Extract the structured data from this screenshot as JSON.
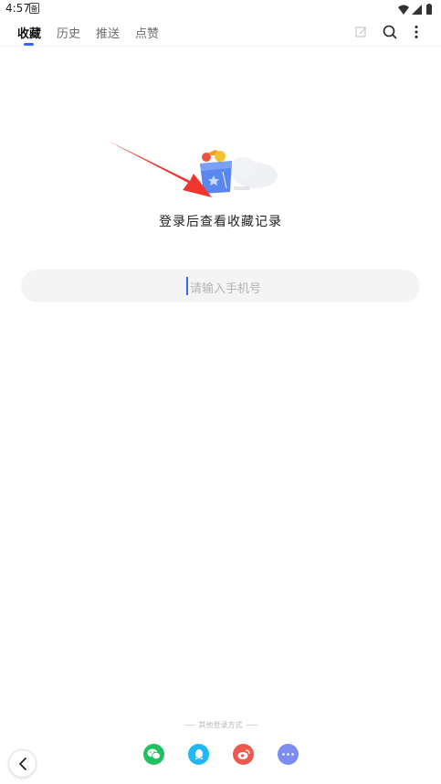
{
  "status_bar": {
    "time": "4:57",
    "badge": "备"
  },
  "tabs": [
    {
      "label": "收藏",
      "active": true
    },
    {
      "label": "历史",
      "active": false
    },
    {
      "label": "推送",
      "active": false
    },
    {
      "label": "点赞",
      "active": false
    }
  ],
  "toolbar": {
    "edit_icon": "edit-icon",
    "search_icon": "search-icon",
    "more_icon": "more-vertical-icon"
  },
  "empty_state": {
    "message": "登录后查看收藏记录",
    "illustration_icon": "favorites-bag-illustration"
  },
  "phone_input": {
    "placeholder": "请输入手机号",
    "value": ""
  },
  "other_login": {
    "label": "其他登录方式",
    "methods": [
      {
        "name": "wechat",
        "icon": "wechat-icon",
        "color": "#1fc160"
      },
      {
        "name": "qq",
        "icon": "qq-icon",
        "color": "#22b7f5"
      },
      {
        "name": "weibo",
        "icon": "weibo-icon",
        "color": "#f0584c"
      },
      {
        "name": "more",
        "icon": "more-horizontal-icon",
        "color": "#7d8cf0"
      }
    ]
  },
  "colors": {
    "accent": "#3b67f6",
    "arrow": "#f0352c"
  }
}
